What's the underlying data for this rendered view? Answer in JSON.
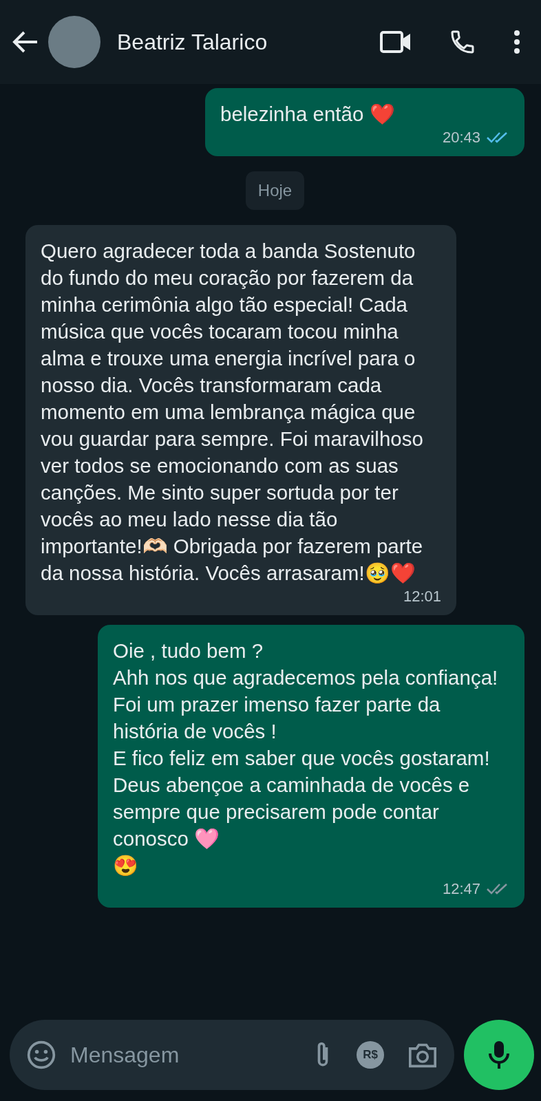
{
  "header": {
    "contact_name": "Beatriz Talarico"
  },
  "messages": [
    {
      "kind": "outgoing",
      "text": "belezinha então ❤️",
      "time": "20:43",
      "read": true
    },
    {
      "kind": "date",
      "text": "Hoje"
    },
    {
      "kind": "incoming",
      "text": "Quero agradecer toda a banda Sostenuto do fundo do meu coração por fazerem da minha cerimônia algo tão especial! Cada música que vocês tocaram tocou minha alma e trouxe uma energia incrível para o nosso dia. Vocês transformaram cada momento em uma lembrança mágica que vou guardar para sempre. Foi maravilhoso ver todos se emocionando com as suas canções. Me sinto super sortuda por ter vocês ao meu lado nesse dia tão importante!🫶🏻 Obrigada por fazerem parte da nossa história. Vocês arrasaram!🥹❤️",
      "time": "12:01"
    },
    {
      "kind": "outgoing",
      "text": "Oie , tudo bem ?\nAhh nos que agradecemos pela confiança! Foi um prazer imenso fazer parte da história de vocês  !\nE fico feliz em saber que vocês gostaram! Deus abençoe a caminhada de vocês e sempre que precisarem pode contar conosco 🩷\n😍",
      "time": "12:47",
      "read": false
    }
  ],
  "composer": {
    "placeholder": "Mensagem",
    "payment_label": "R$"
  }
}
